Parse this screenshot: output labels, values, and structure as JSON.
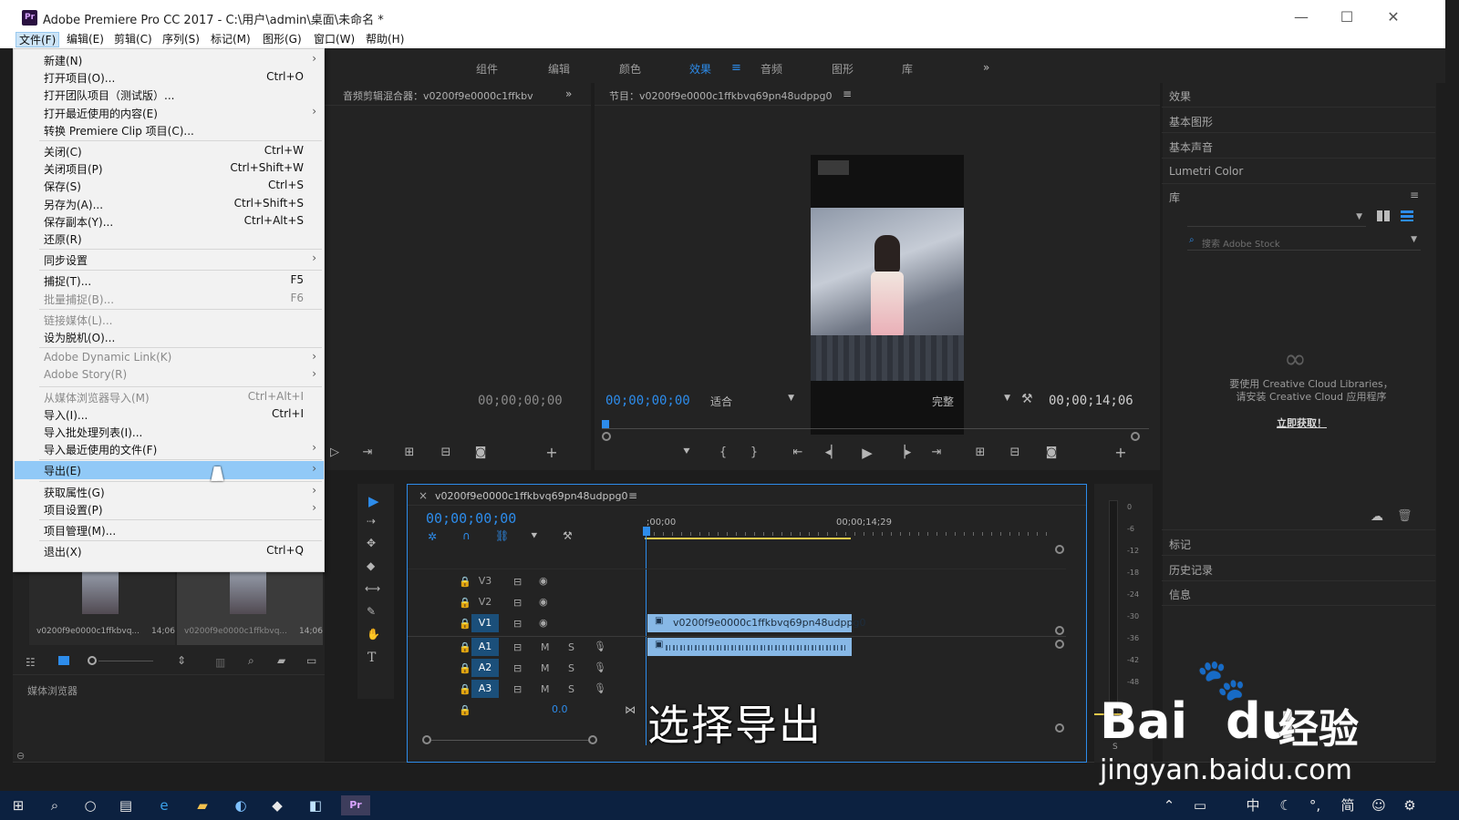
{
  "window": {
    "title": "Adobe Premiere Pro CC 2017 - C:\\用户\\admin\\桌面\\未命名 *",
    "app_icon_text": "Pr",
    "minimize": "—",
    "maximize": "☐",
    "close": "✕"
  },
  "menubar": [
    "文件(F)",
    "编辑(E)",
    "剪辑(C)",
    "序列(S)",
    "标记(M)",
    "图形(G)",
    "窗口(W)",
    "帮助(H)"
  ],
  "workspaces": [
    "组件",
    "编辑",
    "颜色",
    "效果",
    "音频",
    "图形",
    "库"
  ],
  "workspace_more": "»",
  "file_menu": [
    {
      "label": "新建(N)",
      "shortcut": "",
      "arrow": true,
      "disabled": false
    },
    {
      "label": "打开项目(O)...",
      "shortcut": "Ctrl+O",
      "arrow": false,
      "disabled": false
    },
    {
      "label": "打开团队项目（测试版）...",
      "shortcut": "",
      "arrow": false,
      "disabled": false
    },
    {
      "label": "打开最近使用的内容(E)",
      "shortcut": "",
      "arrow": true,
      "disabled": false
    },
    {
      "label": "转换 Premiere Clip 项目(C)...",
      "shortcut": "",
      "arrow": false,
      "disabled": false
    },
    {
      "label": "关闭(C)",
      "shortcut": "Ctrl+W",
      "arrow": false,
      "disabled": false
    },
    {
      "label": "关闭项目(P)",
      "shortcut": "Ctrl+Shift+W",
      "arrow": false,
      "disabled": false
    },
    {
      "label": "保存(S)",
      "shortcut": "Ctrl+S",
      "arrow": false,
      "disabled": false
    },
    {
      "label": "另存为(A)...",
      "shortcut": "Ctrl+Shift+S",
      "arrow": false,
      "disabled": false
    },
    {
      "label": "保存副本(Y)...",
      "shortcut": "Ctrl+Alt+S",
      "arrow": false,
      "disabled": false
    },
    {
      "label": "还原(R)",
      "shortcut": "",
      "arrow": false,
      "disabled": false
    },
    {
      "label": "同步设置",
      "shortcut": "",
      "arrow": true,
      "disabled": false
    },
    {
      "label": "捕捉(T)...",
      "shortcut": "F5",
      "arrow": false,
      "disabled": false
    },
    {
      "label": "批量捕捉(B)...",
      "shortcut": "F6",
      "arrow": false,
      "disabled": true
    },
    {
      "label": "链接媒体(L)...",
      "shortcut": "",
      "arrow": false,
      "disabled": true
    },
    {
      "label": "设为脱机(O)...",
      "shortcut": "",
      "arrow": false,
      "disabled": false
    },
    {
      "label": "Adobe Dynamic Link(K)",
      "shortcut": "",
      "arrow": true,
      "disabled": true
    },
    {
      "label": "Adobe Story(R)",
      "shortcut": "",
      "arrow": true,
      "disabled": true
    },
    {
      "label": "从媒体浏览器导入(M)",
      "shortcut": "Ctrl+Alt+I",
      "arrow": false,
      "disabled": true
    },
    {
      "label": "导入(I)...",
      "shortcut": "Ctrl+I",
      "arrow": false,
      "disabled": false
    },
    {
      "label": "导入批处理列表(I)...",
      "shortcut": "",
      "arrow": false,
      "disabled": false
    },
    {
      "label": "导入最近使用的文件(F)",
      "shortcut": "",
      "arrow": true,
      "disabled": false
    },
    {
      "label": "导出(E)",
      "shortcut": "",
      "arrow": true,
      "disabled": false,
      "highlighted": true
    },
    {
      "label": "获取属性(G)",
      "shortcut": "",
      "arrow": true,
      "disabled": false
    },
    {
      "label": "项目设置(P)",
      "shortcut": "",
      "arrow": true,
      "disabled": false
    },
    {
      "label": "项目管理(M)...",
      "shortcut": "",
      "arrow": false,
      "disabled": false
    },
    {
      "label": "退出(X)",
      "shortcut": "Ctrl+Q",
      "arrow": false,
      "disabled": false
    }
  ],
  "source_panel": {
    "title": "音频剪辑混合器：v0200f9e0000c1ffkbv",
    "timecode": "00;00;00;00"
  },
  "program_panel": {
    "title": "节目：v0200f9e0000c1ffkbvq69pn48udppg0",
    "timecode": "00;00;00;00",
    "fit": "适合",
    "quality": "完整",
    "duration": "00;00;14;06"
  },
  "project_bin": {
    "items": [
      {
        "name": "v0200f9e0000c1ffkbvq...",
        "duration": "14;06"
      },
      {
        "name": "v0200f9e0000c1ffkbvq...",
        "duration": "14;06"
      }
    ],
    "media_browser": "媒体浏览器"
  },
  "timeline": {
    "tab_close": "×",
    "sequence_name": "v0200f9e0000c1ffkbvq69pn48udppg0",
    "timecode": "00;00;00;00",
    "ruler_start": ";00;00",
    "ruler_mid": "00;00;14;29",
    "tracks": [
      "V3",
      "V2",
      "V1",
      "A1",
      "A2",
      "A3"
    ],
    "master_value": "0.0",
    "clip_name": "v0200f9e0000c1ffkbvq69pn48udppg0",
    "mute": "M",
    "solo": "S"
  },
  "meter": {
    "scale": [
      "0",
      "-6",
      "-12",
      "-18",
      "-24",
      "-30",
      "-36",
      "-42",
      "-48"
    ],
    "solo_label": "S"
  },
  "right_panel": {
    "items": [
      "效果",
      "基本图形",
      "基本声音",
      "Lumetri Color",
      "库"
    ],
    "search_placeholder": "搜索 Adobe Stock",
    "cc_message_line1": "要使用 Creative Cloud Libraries，",
    "cc_message_line2": "请安装 Creative Cloud 应用程序",
    "cc_link": "立即获取！",
    "bottom_items": [
      "标记",
      "历史记录",
      "信息"
    ]
  },
  "caption": "选择导出",
  "watermark": {
    "brand": "Bai",
    "brand2": "du",
    "brand_cn": "经验",
    "url": "jingyan.baidu.com"
  },
  "taskbar": {
    "ime_items": [
      "中",
      "简"
    ]
  },
  "colors": {
    "accent": "#2d8ceb",
    "menu_highlight": "#91c9f7",
    "clip_blue": "#87b8e6",
    "taskbar": "#0c2140"
  }
}
